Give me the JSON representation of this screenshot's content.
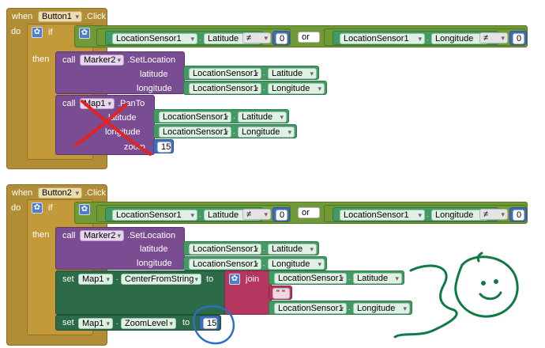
{
  "event1": {
    "when": "when",
    "component": "Button1",
    "event": ".Click",
    "do": "do",
    "if": "if",
    "then": "then",
    "cond_left": {
      "component": "LocationSensor1",
      "property": "Latitude",
      "op": "≠",
      "value": "0"
    },
    "or": "or",
    "cond_right": {
      "component": "LocationSensor1",
      "property": "Longitude",
      "op": "≠",
      "value": "0"
    },
    "call1": {
      "call": "call",
      "component": "Marker2",
      "method": ".SetLocation",
      "arg1": "latitude",
      "arg1_component": "LocationSensor1",
      "arg1_property": "Latitude",
      "arg2": "longitude",
      "arg2_component": "LocationSensor1",
      "arg2_property": "Longitude"
    },
    "call2": {
      "call": "call",
      "component": "Map1",
      "method": ".PanTo",
      "arg1": "latitude",
      "arg1_component": "LocationSensor1",
      "arg1_property": "Latitude",
      "arg2": "longitude",
      "arg2_component": "LocationSensor1",
      "arg2_property": "Longitude",
      "arg3": "zoom",
      "arg3_value": "15"
    }
  },
  "event2": {
    "when": "when",
    "component": "Button2",
    "event": ".Click",
    "do": "do",
    "if": "if",
    "then": "then",
    "cond_left": {
      "component": "LocationSensor1",
      "property": "Latitude",
      "op": "≠",
      "value": "0"
    },
    "or": "or",
    "cond_right": {
      "component": "LocationSensor1",
      "property": "Longitude",
      "op": "≠",
      "value": "0"
    },
    "call1": {
      "call": "call",
      "component": "Marker2",
      "method": ".SetLocation",
      "arg1": "latitude",
      "arg1_component": "LocationSensor1",
      "arg1_property": "Latitude",
      "arg2": "longitude",
      "arg2_component": "LocationSensor1",
      "arg2_property": "Longitude"
    },
    "set1": {
      "set": "set",
      "component": "Map1",
      "property": "CenterFromString",
      "to": "to",
      "join": "join",
      "join_item1_component": "LocationSensor1",
      "join_item1_property": "Latitude",
      "join_text": "\" \"",
      "join_item2_component": "LocationSensor1",
      "join_item2_property": "Longitude"
    },
    "set2": {
      "set": "set",
      "component": "Map1",
      "property": "ZoomLevel",
      "to": "to",
      "value": "15"
    }
  },
  "colors": {
    "event": "#b18e35",
    "control": "#c29a3a",
    "logic": "#6f9a35",
    "component": "#449a65",
    "procedure": "#7a4d93",
    "setter": "#2d6a48",
    "text": "#b5365f",
    "number": "#3d6ebc",
    "cross": "#e02424",
    "circle": "#2b6fc2",
    "doodle": "#0f7a45"
  }
}
